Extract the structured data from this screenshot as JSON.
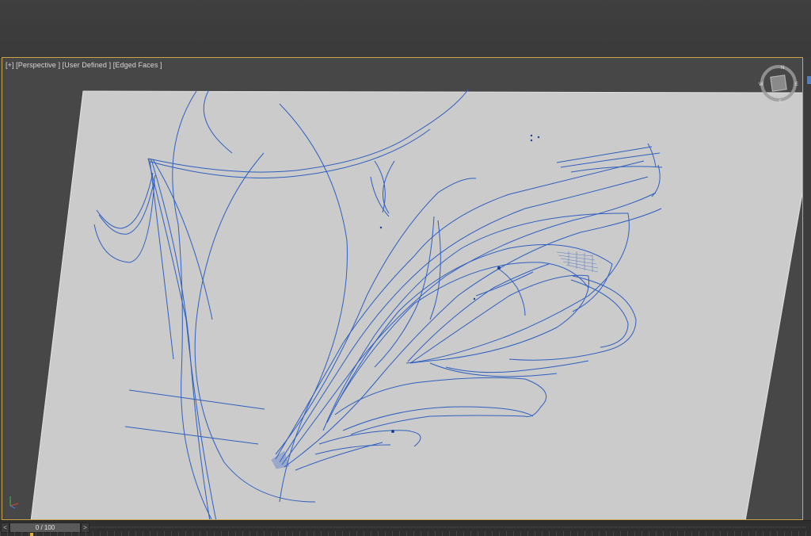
{
  "viewport": {
    "label": "[+] [Perspective ] [User Defined ] [Edged Faces ]"
  },
  "viewcube": {
    "north_label": "N",
    "south_label": "S",
    "east_label": "E",
    "west_label": "W"
  },
  "timeline": {
    "prev_label": "<",
    "next_label": ">",
    "frame_readout": "0 / 100"
  },
  "colors": {
    "curve": "#2f5fbf",
    "plane": "#cbcbcb",
    "active_border": "#c9a44a"
  }
}
